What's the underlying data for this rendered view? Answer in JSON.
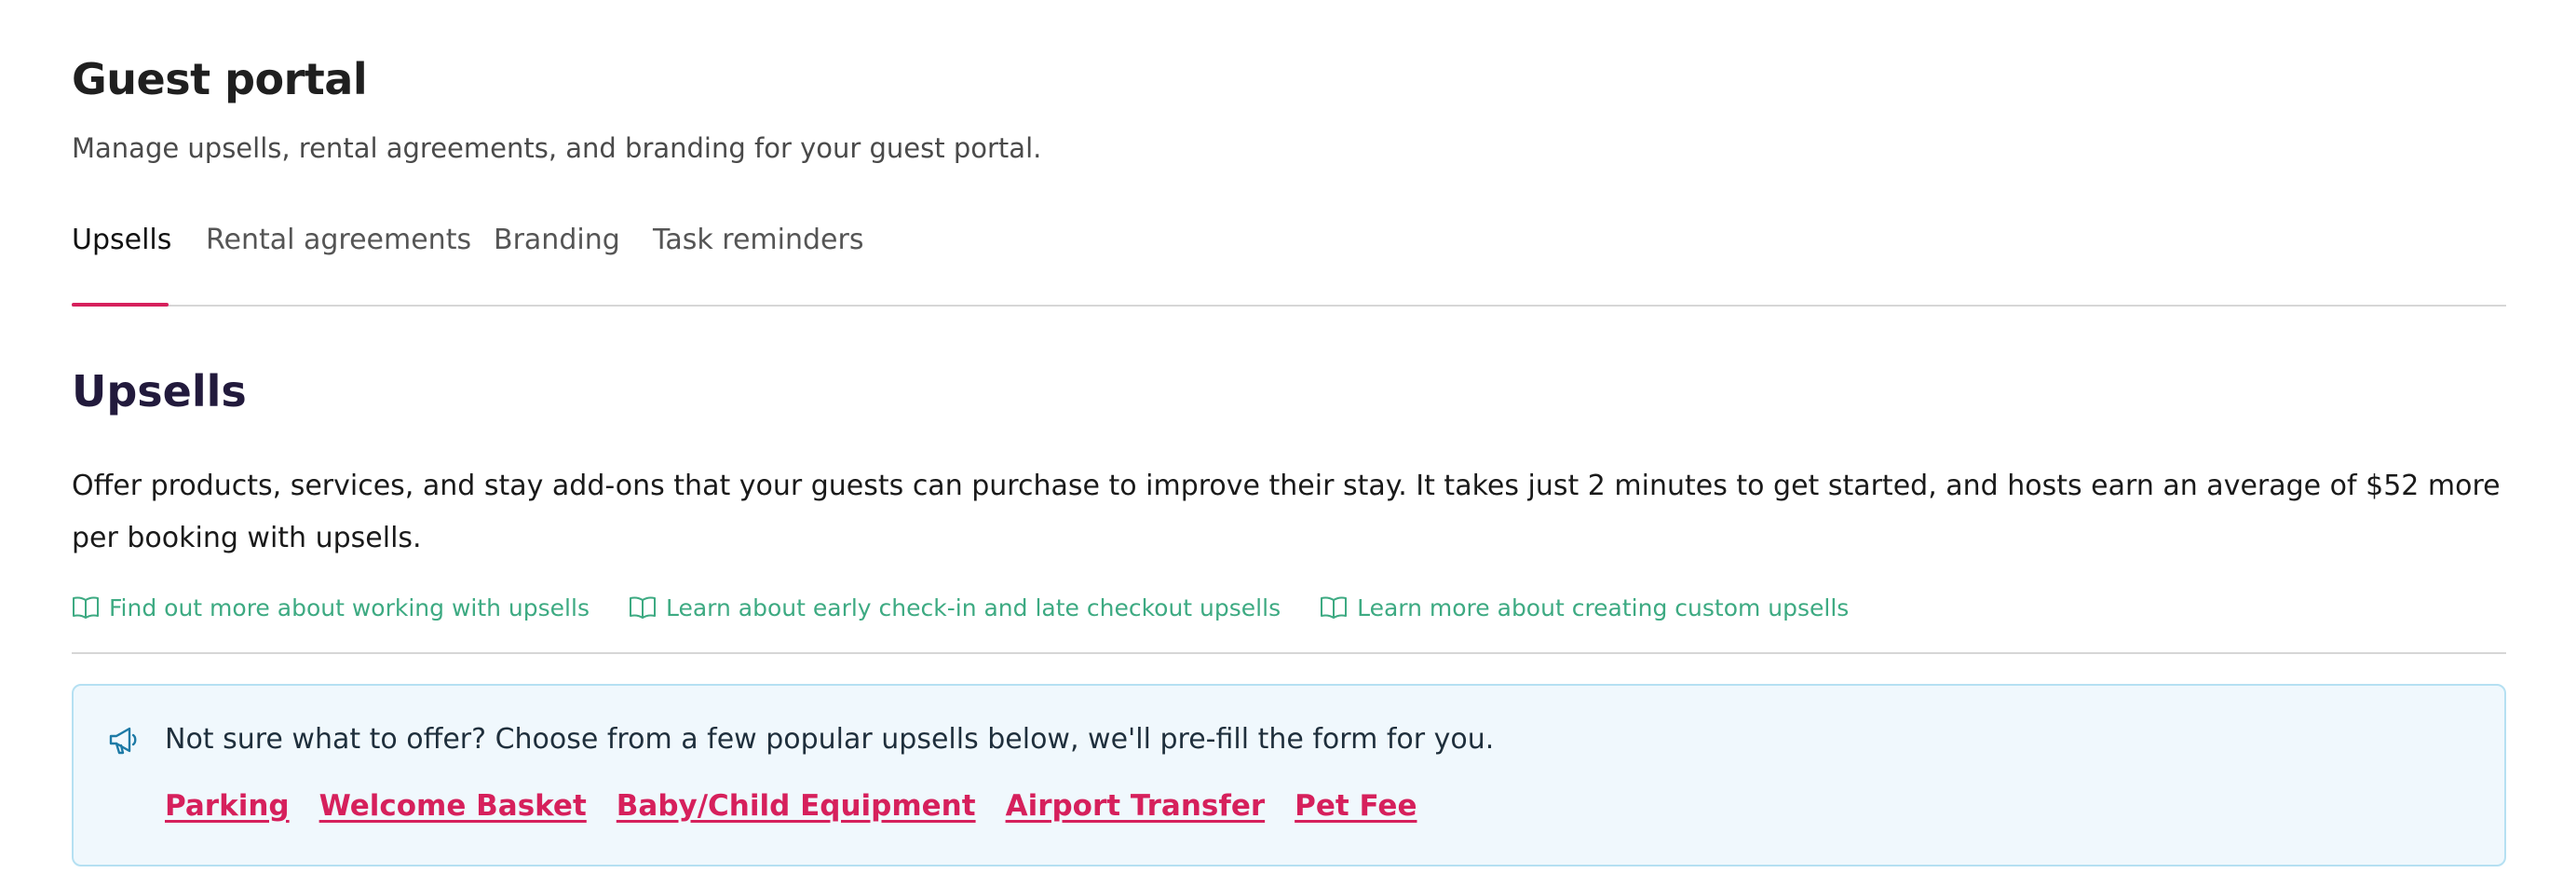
{
  "header": {
    "title": "Guest portal",
    "subtitle": "Manage upsells, rental agreements, and branding for your guest portal."
  },
  "tabs": [
    {
      "label": "Upsells",
      "active": true
    },
    {
      "label": "Rental agreements",
      "active": false
    },
    {
      "label": "Branding",
      "active": false
    },
    {
      "label": "Task reminders",
      "active": false
    }
  ],
  "section": {
    "title": "Upsells",
    "description": "Offer products, services, and stay add-ons that your guests can purchase to improve their stay. It takes just 2 minutes to get started, and hosts earn an average of $52 more per booking with upsells."
  },
  "help_links": [
    {
      "label": "Find out more about working with upsells",
      "icon": "book-icon"
    },
    {
      "label": "Learn about early check-in and late checkout upsells",
      "icon": "book-icon"
    },
    {
      "label": "Learn more about creating custom upsells",
      "icon": "book-icon"
    }
  ],
  "suggestions": {
    "icon": "megaphone-icon",
    "text": "Not sure what to offer? Choose from a few popular upsells below, we'll pre-fill the form for you.",
    "links": [
      "Parking",
      "Welcome Basket",
      "Baby/Child Equipment",
      "Airport Transfer",
      "Pet Fee"
    ]
  },
  "colors": {
    "accent": "#d6205c",
    "link_green": "#3daa82",
    "info_bg": "#f0f8fd",
    "info_border": "#b5e0f2",
    "section_title": "#221a3c"
  }
}
